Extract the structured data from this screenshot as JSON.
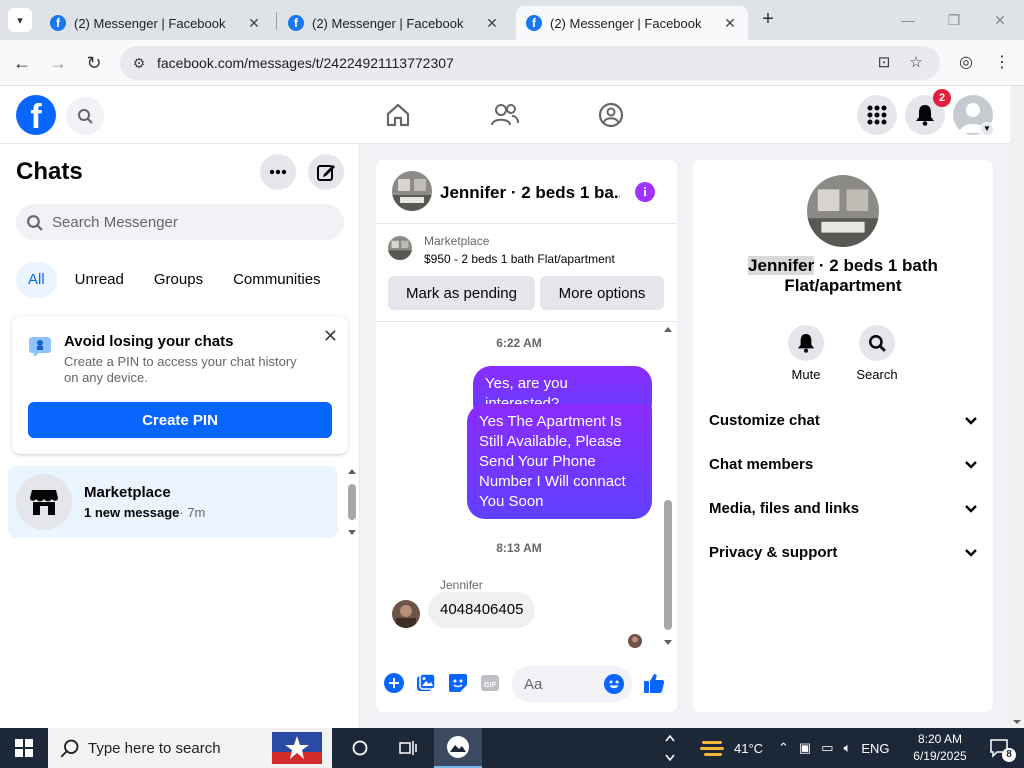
{
  "browser": {
    "tabs": [
      {
        "title": "(2) Messenger | Facebook",
        "active": false
      },
      {
        "title": "(2) Messenger | Facebook",
        "active": false
      },
      {
        "title": "(2) Messenger | Facebook",
        "active": true
      }
    ],
    "url": "facebook.com/messages/t/24224921113772307"
  },
  "header": {
    "notification_count": "2"
  },
  "chats": {
    "title": "Chats",
    "search_placeholder": "Search Messenger",
    "filters": [
      "All",
      "Unread",
      "Groups",
      "Communities"
    ],
    "active_filter": "All",
    "pin_card": {
      "title": "Avoid losing your chats",
      "body": "Create a PIN to access your chat history on any device.",
      "button": "Create PIN"
    },
    "threads": [
      {
        "name": "Marketplace",
        "preview": "1 new message",
        "time": "· 7m"
      }
    ]
  },
  "conversation": {
    "title": "Jennifer · 2 beds 1 ba...",
    "marketplace_label": "Marketplace",
    "listing": "$950 - 2 beds 1 bath Flat/apartment",
    "mark_pending": "Mark as pending",
    "more_options": "More options",
    "messages": [
      {
        "type": "time",
        "text": "6:22 AM"
      },
      {
        "type": "out",
        "text": "Yes, are you interested?"
      },
      {
        "type": "out",
        "text": "Yes The Apartment Is Still Available, Please Send Your Phone Number I Will connact You Soon"
      },
      {
        "type": "time",
        "text": "8:13 AM"
      },
      {
        "type": "sender",
        "text": "Jennifer"
      },
      {
        "type": "in",
        "text": "4048406405"
      }
    ],
    "composer_placeholder": "Aa"
  },
  "details": {
    "name_highlight": "Jennifer",
    "name_rest": " · 2 beds 1 bath Flat/apartment",
    "actions": [
      {
        "label": "Mute",
        "icon": "bell-icon"
      },
      {
        "label": "Search",
        "icon": "search-icon"
      }
    ],
    "sections": [
      "Customize chat",
      "Chat members",
      "Media, files and links",
      "Privacy & support"
    ]
  },
  "taskbar": {
    "search_placeholder": "Type here to search",
    "temperature": "41°C",
    "language": "ENG",
    "time": "8:20 AM",
    "date": "6/19/2025",
    "notification_count": "8"
  },
  "colors": {
    "brand": "#0866ff",
    "messenger_purple": "#8a2bff",
    "badge_red": "#e41e3f"
  }
}
